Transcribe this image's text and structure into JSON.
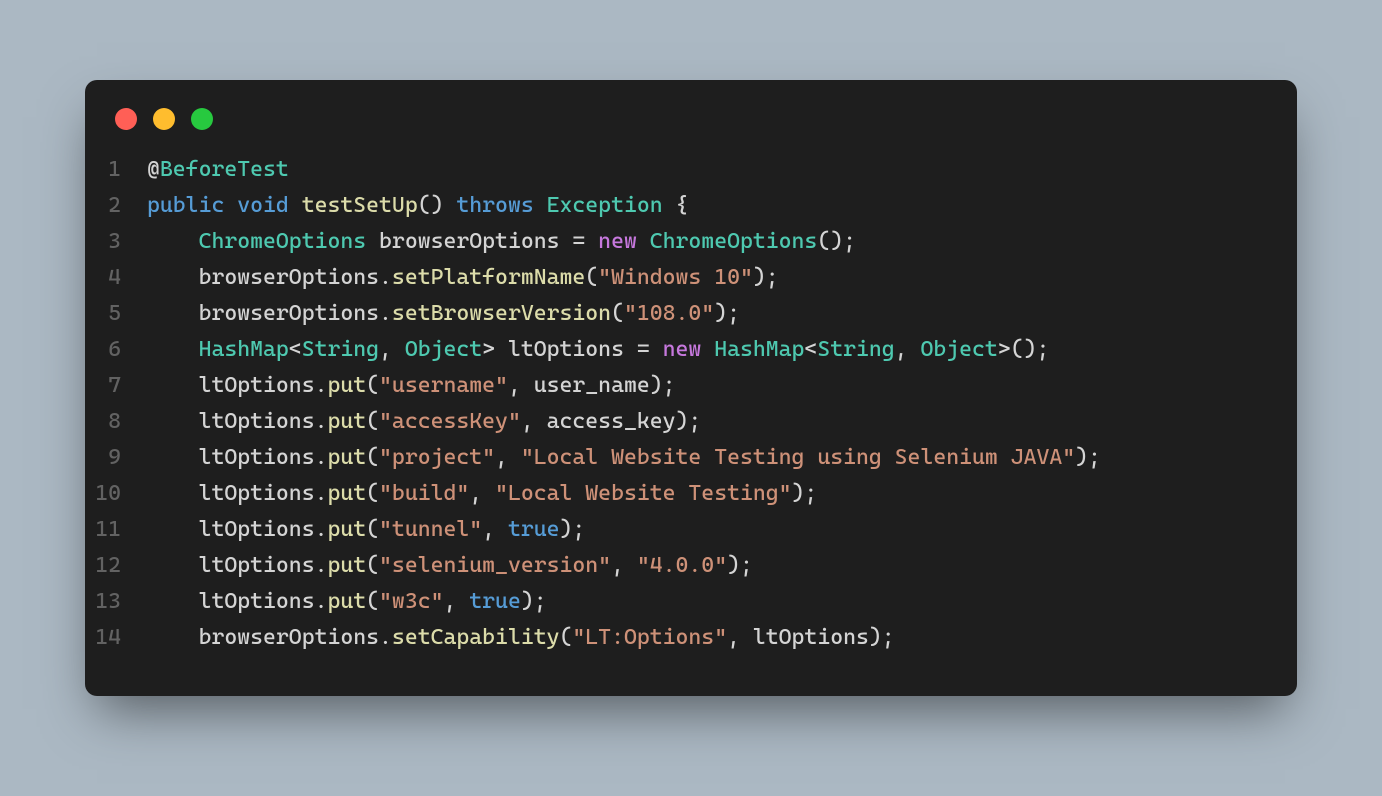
{
  "window": {
    "dots": [
      "red",
      "yellow",
      "green"
    ]
  },
  "code": {
    "lines": [
      {
        "n": "1",
        "indent": "",
        "tokens": [
          {
            "t": "@",
            "c": "c-at"
          },
          {
            "t": "BeforeTest",
            "c": "c-annotation"
          }
        ]
      },
      {
        "n": "2",
        "indent": "",
        "tokens": [
          {
            "t": "public",
            "c": "c-keyword"
          },
          {
            "t": " ",
            "c": ""
          },
          {
            "t": "void",
            "c": "c-keyword"
          },
          {
            "t": " ",
            "c": ""
          },
          {
            "t": "testSetUp",
            "c": "c-method"
          },
          {
            "t": "() ",
            "c": "c-punct"
          },
          {
            "t": "throws",
            "c": "c-keyword"
          },
          {
            "t": " ",
            "c": ""
          },
          {
            "t": "Exception",
            "c": "c-type"
          },
          {
            "t": " {",
            "c": "c-punct"
          }
        ]
      },
      {
        "n": "3",
        "indent": "    ",
        "tokens": [
          {
            "t": "ChromeOptions",
            "c": "c-type"
          },
          {
            "t": " browserOptions = ",
            "c": "c-var"
          },
          {
            "t": "new",
            "c": "c-newkw"
          },
          {
            "t": " ",
            "c": ""
          },
          {
            "t": "ChromeOptions",
            "c": "c-type"
          },
          {
            "t": "();",
            "c": "c-punct"
          }
        ]
      },
      {
        "n": "4",
        "indent": "    ",
        "tokens": [
          {
            "t": "browserOptions.",
            "c": "c-var"
          },
          {
            "t": "setPlatformName",
            "c": "c-method"
          },
          {
            "t": "(",
            "c": "c-punct"
          },
          {
            "t": "\"Windows 10\"",
            "c": "c-string"
          },
          {
            "t": ");",
            "c": "c-punct"
          }
        ]
      },
      {
        "n": "5",
        "indent": "    ",
        "tokens": [
          {
            "t": "browserOptions.",
            "c": "c-var"
          },
          {
            "t": "setBrowserVersion",
            "c": "c-method"
          },
          {
            "t": "(",
            "c": "c-punct"
          },
          {
            "t": "\"108.0\"",
            "c": "c-string"
          },
          {
            "t": ");",
            "c": "c-punct"
          }
        ]
      },
      {
        "n": "6",
        "indent": "    ",
        "tokens": [
          {
            "t": "HashMap",
            "c": "c-type"
          },
          {
            "t": "<",
            "c": "c-punct"
          },
          {
            "t": "String",
            "c": "c-type"
          },
          {
            "t": ", ",
            "c": "c-punct"
          },
          {
            "t": "Object",
            "c": "c-type"
          },
          {
            "t": "> ltOptions = ",
            "c": "c-var"
          },
          {
            "t": "new",
            "c": "c-newkw"
          },
          {
            "t": " ",
            "c": ""
          },
          {
            "t": "HashMap",
            "c": "c-type"
          },
          {
            "t": "<",
            "c": "c-punct"
          },
          {
            "t": "String",
            "c": "c-type"
          },
          {
            "t": ", ",
            "c": "c-punct"
          },
          {
            "t": "Object",
            "c": "c-type"
          },
          {
            "t": ">();",
            "c": "c-punct"
          }
        ]
      },
      {
        "n": "7",
        "indent": "    ",
        "tokens": [
          {
            "t": "ltOptions.",
            "c": "c-var"
          },
          {
            "t": "put",
            "c": "c-method"
          },
          {
            "t": "(",
            "c": "c-punct"
          },
          {
            "t": "\"username\"",
            "c": "c-string"
          },
          {
            "t": ", user_name);",
            "c": "c-var"
          }
        ]
      },
      {
        "n": "8",
        "indent": "    ",
        "tokens": [
          {
            "t": "ltOptions.",
            "c": "c-var"
          },
          {
            "t": "put",
            "c": "c-method"
          },
          {
            "t": "(",
            "c": "c-punct"
          },
          {
            "t": "\"accessKey\"",
            "c": "c-string"
          },
          {
            "t": ", access_key);",
            "c": "c-var"
          }
        ]
      },
      {
        "n": "9",
        "indent": "    ",
        "tokens": [
          {
            "t": "ltOptions.",
            "c": "c-var"
          },
          {
            "t": "put",
            "c": "c-method"
          },
          {
            "t": "(",
            "c": "c-punct"
          },
          {
            "t": "\"project\"",
            "c": "c-string"
          },
          {
            "t": ", ",
            "c": "c-punct"
          },
          {
            "t": "\"Local Website Testing using Selenium JAVA\"",
            "c": "c-string"
          },
          {
            "t": ");",
            "c": "c-punct"
          }
        ]
      },
      {
        "n": "10",
        "indent": "    ",
        "tokens": [
          {
            "t": "ltOptions.",
            "c": "c-var"
          },
          {
            "t": "put",
            "c": "c-method"
          },
          {
            "t": "(",
            "c": "c-punct"
          },
          {
            "t": "\"build\"",
            "c": "c-string"
          },
          {
            "t": ", ",
            "c": "c-punct"
          },
          {
            "t": "\"Local Website Testing\"",
            "c": "c-string"
          },
          {
            "t": ");",
            "c": "c-punct"
          }
        ]
      },
      {
        "n": "11",
        "indent": "    ",
        "tokens": [
          {
            "t": "ltOptions.",
            "c": "c-var"
          },
          {
            "t": "put",
            "c": "c-method"
          },
          {
            "t": "(",
            "c": "c-punct"
          },
          {
            "t": "\"tunnel\"",
            "c": "c-string"
          },
          {
            "t": ", ",
            "c": "c-punct"
          },
          {
            "t": "true",
            "c": "c-bool"
          },
          {
            "t": ");",
            "c": "c-punct"
          }
        ]
      },
      {
        "n": "12",
        "indent": "    ",
        "tokens": [
          {
            "t": "ltOptions.",
            "c": "c-var"
          },
          {
            "t": "put",
            "c": "c-method"
          },
          {
            "t": "(",
            "c": "c-punct"
          },
          {
            "t": "\"selenium_version\"",
            "c": "c-string"
          },
          {
            "t": ", ",
            "c": "c-punct"
          },
          {
            "t": "\"4.0.0\"",
            "c": "c-string"
          },
          {
            "t": ");",
            "c": "c-punct"
          }
        ]
      },
      {
        "n": "13",
        "indent": "    ",
        "tokens": [
          {
            "t": "ltOptions.",
            "c": "c-var"
          },
          {
            "t": "put",
            "c": "c-method"
          },
          {
            "t": "(",
            "c": "c-punct"
          },
          {
            "t": "\"w3c\"",
            "c": "c-string"
          },
          {
            "t": ", ",
            "c": "c-punct"
          },
          {
            "t": "true",
            "c": "c-bool"
          },
          {
            "t": ");",
            "c": "c-punct"
          }
        ]
      },
      {
        "n": "14",
        "indent": "    ",
        "tokens": [
          {
            "t": "browserOptions.",
            "c": "c-var"
          },
          {
            "t": "setCapability",
            "c": "c-method"
          },
          {
            "t": "(",
            "c": "c-punct"
          },
          {
            "t": "\"LT:Options\"",
            "c": "c-string"
          },
          {
            "t": ", ltOptions);",
            "c": "c-var"
          }
        ]
      }
    ]
  }
}
